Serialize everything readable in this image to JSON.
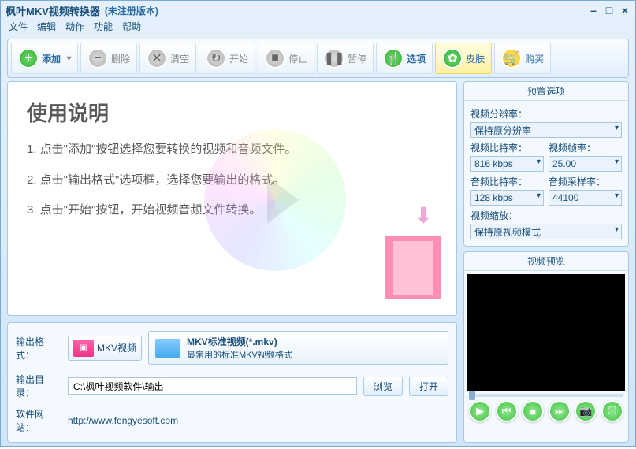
{
  "titlebar": {
    "title": "枫叶MKV视频转换器",
    "subtitle": "(未注册版本)"
  },
  "menu": [
    "文件",
    "编辑",
    "动作",
    "功能",
    "帮助"
  ],
  "toolbar": {
    "add": "添加",
    "delete": "删除",
    "clear": "清空",
    "start": "开始",
    "stop": "停止",
    "pause": "暂停",
    "options": "选项",
    "skin": "皮肤",
    "buy": "购买"
  },
  "instructions": {
    "heading": "使用说明",
    "steps": [
      "1. 点击\"添加\"按钮选择您要转换的视频和音频文件。",
      "2. 点击\"输出格式\"选项框，选择您要输出的格式。",
      "3. 点击\"开始\"按钮，开始视频音频文件转换。"
    ]
  },
  "output": {
    "format_label": "输出格式：",
    "format_btn": "MKV视频",
    "format_title": "MKV标准视频(*.mkv)",
    "format_desc": "最常用的标准MKV视频格式",
    "dir_label": "输出目录：",
    "dir_value": "C:\\枫叶视频软件\\输出",
    "browse": "浏览",
    "open": "打开",
    "site_label": "软件网站：",
    "site_url": "http://www.fengyesoft.com"
  },
  "preset": {
    "title": "预置选项",
    "video_res_label": "视频分辨率：",
    "video_res": "保持原分辨率",
    "video_bitrate_label": "视频比特率：",
    "video_bitrate": "816 kbps",
    "video_fps_label": "视频帧率：",
    "video_fps": "25.00",
    "audio_bitrate_label": "音频比特率：",
    "audio_bitrate": "128 kbps",
    "audio_rate_label": "音频采样率：",
    "audio_rate": "44100",
    "video_zoom_label": "视频缩放：",
    "video_zoom": "保持原视频模式"
  },
  "preview": {
    "title": "视频预览"
  }
}
